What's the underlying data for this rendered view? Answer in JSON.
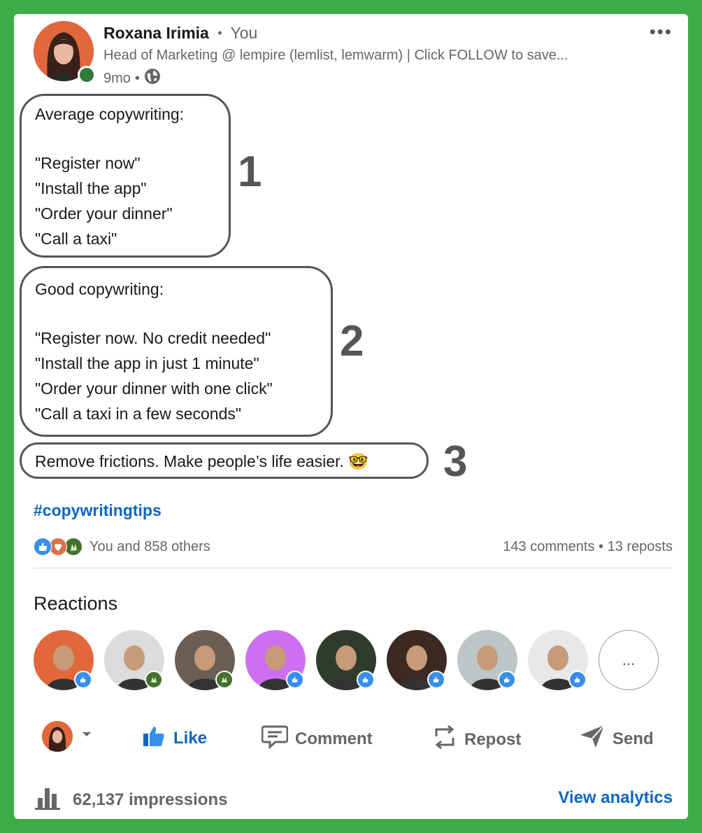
{
  "post": {
    "author": "Roxana Irimia",
    "separator": "•",
    "you_label": "You",
    "headline": "Head of Marketing @ lempire (lemlist, lemwarm) | Click FOLLOW to save...",
    "age": "9mo",
    "meta_sep": "•",
    "more_label": "•••"
  },
  "content": {
    "box1": {
      "title": "Average copywriting:",
      "lines": [
        "\"Register now\"",
        "\"Install the app\"",
        "\"Order your dinner\"",
        "\"Call a taxi\""
      ],
      "number": "1"
    },
    "box2": {
      "title": "Good copywriting:",
      "lines": [
        "\"Register now. No credit needed\"",
        "\"Install the app in just 1 minute\"",
        "\"Order your dinner with one click\"",
        "\"Call a taxi in a few seconds\""
      ],
      "number": "2"
    },
    "box3": {
      "text": "Remove frictions. Make people’s life easier. 🤓",
      "number": "3"
    },
    "hashtag": "#copywritingtips"
  },
  "social": {
    "reactions_summary": "You and 858 others",
    "comments_reposts": "143 comments • 13 reposts",
    "reaction_icons": [
      "like-icon",
      "love-icon",
      "celebrate-icon"
    ]
  },
  "reactions": {
    "title": "Reactions",
    "more_label": "...",
    "people": [
      {
        "badge": "like",
        "bg": "#e2683c"
      },
      {
        "badge": "celebrate",
        "bg": "#dcdcdc"
      },
      {
        "badge": "celebrate",
        "bg": "#6a5e55"
      },
      {
        "badge": "like",
        "bg": "#cd6ff0"
      },
      {
        "badge": "like",
        "bg": "#2f3b2c"
      },
      {
        "badge": "like",
        "bg": "#3c2a22"
      },
      {
        "badge": "like",
        "bg": "#bcc6c6"
      },
      {
        "badge": "like",
        "bg": "#e8e8e8"
      }
    ]
  },
  "actions": {
    "like": "Like",
    "comment": "Comment",
    "repost": "Repost",
    "send": "Send"
  },
  "footer": {
    "impressions": "62,137 impressions",
    "analytics": "View analytics"
  },
  "colors": {
    "frame": "#3fab47",
    "link": "#0a66c2",
    "muted": "#666666"
  }
}
